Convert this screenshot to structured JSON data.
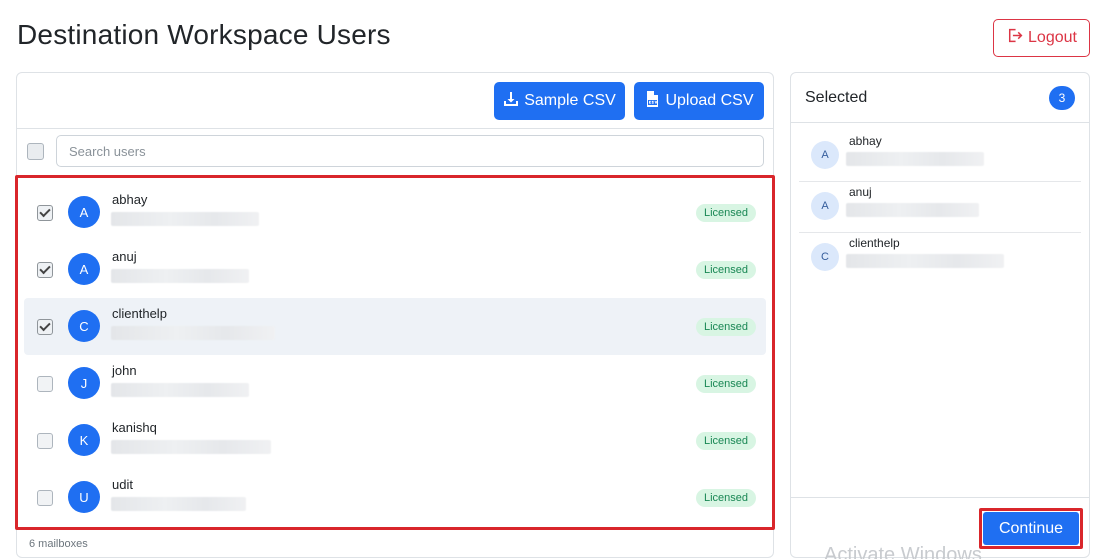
{
  "page": {
    "title": "Destination Workspace Users"
  },
  "header": {
    "logout_label": "Logout"
  },
  "toolbar": {
    "sample_csv_label": "Sample CSV",
    "upload_csv_label": "Upload CSV"
  },
  "search": {
    "placeholder": "Search users",
    "value": ""
  },
  "users": [
    {
      "initial": "A",
      "name": "abhay",
      "checked": true,
      "badge": "Licensed",
      "email_redacted_width": 148
    },
    {
      "initial": "A",
      "name": "anuj",
      "checked": true,
      "badge": "Licensed",
      "email_redacted_width": 138
    },
    {
      "initial": "C",
      "name": "clienthelp",
      "checked": true,
      "badge": "Licensed",
      "email_redacted_width": 164,
      "highlighted": true
    },
    {
      "initial": "J",
      "name": "john",
      "checked": false,
      "badge": "Licensed",
      "email_redacted_width": 138
    },
    {
      "initial": "K",
      "name": "kanishq",
      "checked": false,
      "badge": "Licensed",
      "email_redacted_width": 160
    },
    {
      "initial": "U",
      "name": "udit",
      "checked": false,
      "badge": "Licensed",
      "email_redacted_width": 135
    }
  ],
  "footer": {
    "count_text": "6 mailboxes"
  },
  "selected_panel": {
    "title": "Selected",
    "count": "3",
    "items": [
      {
        "initial": "A",
        "name": "abhay",
        "email_redacted_width": 138
      },
      {
        "initial": "A",
        "name": "anuj",
        "email_redacted_width": 133
      },
      {
        "initial": "C",
        "name": "clienthelp",
        "email_redacted_width": 158
      }
    ],
    "continue_label": "Continue"
  },
  "watermark": "Activate Windows",
  "colors": {
    "primary": "#1f6ff2",
    "danger": "#dc3545",
    "badge_bg": "#d8f5e3",
    "badge_text": "#198754",
    "highlight_border": "#d9262b"
  },
  "icons": {
    "logout": "logout-icon",
    "sample_csv": "download-icon",
    "upload_csv": "csv-file-icon"
  }
}
